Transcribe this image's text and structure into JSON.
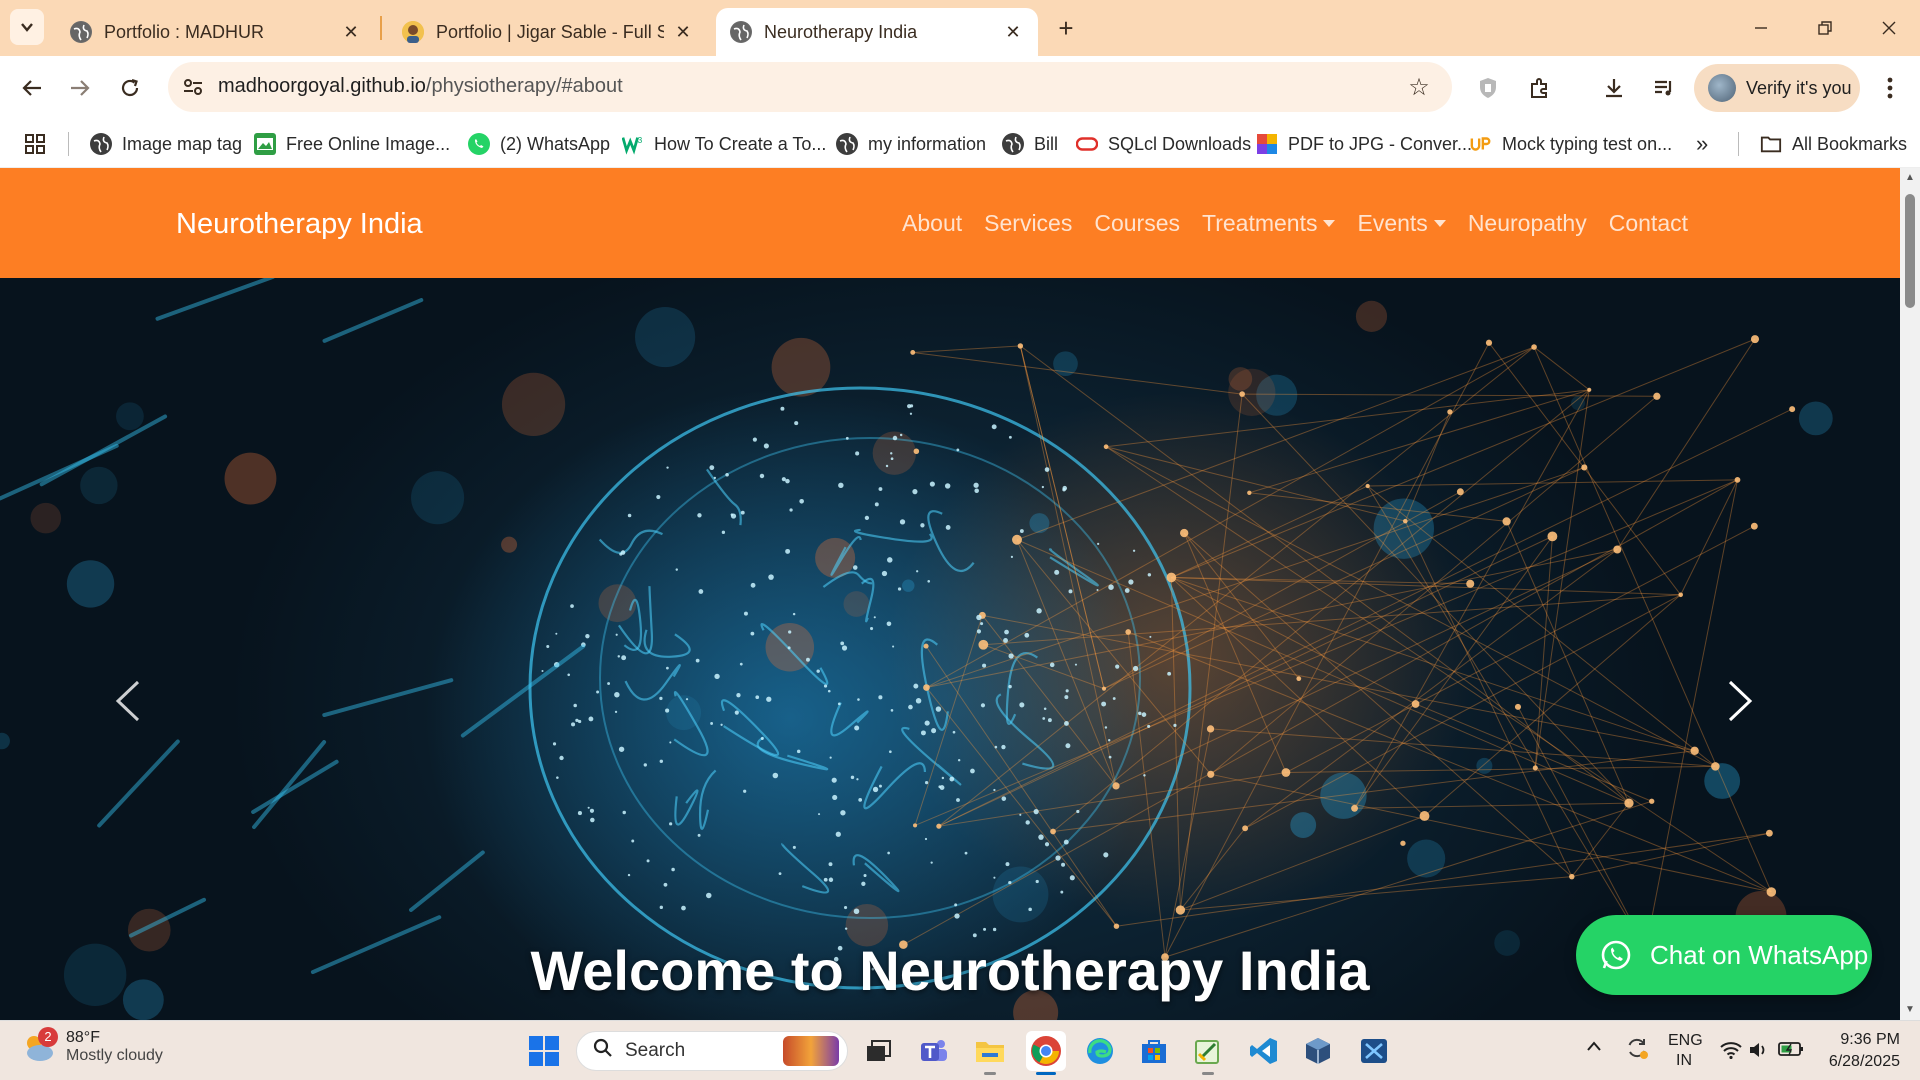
{
  "browser": {
    "tabs": [
      {
        "title": "Portfolio : MADHUR",
        "active": false
      },
      {
        "title": "Portfolio | Jigar Sable - Full Stac",
        "active": false
      },
      {
        "title": "Neurotherapy India",
        "active": true
      }
    ],
    "url_host": "madhoorgoyal.github.io",
    "url_path": "/physiotherapy/#about",
    "verify_label": "Verify it's you",
    "bookmarks": [
      {
        "label": "Image map tag",
        "icon": "globe-icon"
      },
      {
        "label": "Free Online Image...",
        "icon": "image-icon"
      },
      {
        "label": "(2) WhatsApp",
        "icon": "whatsapp-icon"
      },
      {
        "label": "How To Create a To...",
        "icon": "w3-icon"
      },
      {
        "label": "my information",
        "icon": "globe-icon"
      },
      {
        "label": "Bill",
        "icon": "globe-icon"
      },
      {
        "label": "SQLcl Downloads",
        "icon": "oracle-icon"
      },
      {
        "label": "PDF to JPG - Conver...",
        "icon": "pdf-icon"
      },
      {
        "label": "Mock typing test on...",
        "icon": "up-icon"
      }
    ],
    "all_bookmarks_label": "All Bookmarks"
  },
  "site": {
    "brand": "Neurotherapy India",
    "nav": [
      {
        "label": "About",
        "dropdown": false
      },
      {
        "label": "Services",
        "dropdown": false
      },
      {
        "label": "Courses",
        "dropdown": false
      },
      {
        "label": "Treatments",
        "dropdown": true
      },
      {
        "label": "Events",
        "dropdown": true
      },
      {
        "label": "Neuropathy",
        "dropdown": false
      },
      {
        "label": "Contact",
        "dropdown": false
      }
    ],
    "hero_title": "Welcome to Neurotherapy India",
    "whatsapp_label": "Chat on WhatsApp",
    "colors": {
      "navbar": "#fd7e23",
      "whatsapp": "#25d366"
    }
  },
  "taskbar": {
    "weather_badge": "2",
    "weather_temp": "88°F",
    "weather_desc": "Mostly cloudy",
    "search_placeholder": "Search",
    "lang_line1": "ENG",
    "lang_line2": "IN",
    "time": "9:36 PM",
    "date": "6/28/2025"
  }
}
